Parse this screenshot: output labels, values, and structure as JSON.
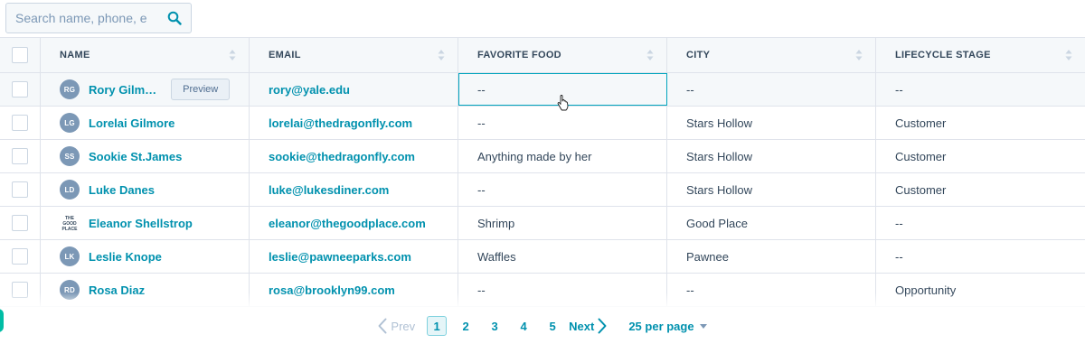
{
  "search": {
    "placeholder": "Search name, phone, e",
    "icon": "search-icon"
  },
  "columns": [
    "NAME",
    "EMAIL",
    "FAVORITE FOOD",
    "CITY",
    "LIFECYCLE STAGE"
  ],
  "rows": [
    {
      "initials": "RG",
      "name": "Rory Gilm…",
      "email": "rory@yale.edu",
      "food": "--",
      "city": "--",
      "stage": "--"
    },
    {
      "initials": "LG",
      "name": "Lorelai Gilmore",
      "email": "lorelai@thedragonfly.com",
      "food": "--",
      "city": "Stars Hollow",
      "stage": "Customer"
    },
    {
      "initials": "SS",
      "name": "Sookie St.James",
      "email": "sookie@thedragonfly.com",
      "food": "Anything made by her",
      "city": "Stars Hollow",
      "stage": "Customer"
    },
    {
      "initials": "LD",
      "name": "Luke Danes",
      "email": "luke@lukesdiner.com",
      "food": "--",
      "city": "Stars Hollow",
      "stage": "Customer"
    },
    {
      "logo": "the-good-place-logo",
      "logo_text": [
        "THE",
        "GOOD",
        "PLACE"
      ],
      "name": "Eleanor Shellstrop",
      "email": "eleanor@thegoodplace.com",
      "food": "Shrimp",
      "city": "Good Place",
      "stage": "--"
    },
    {
      "initials": "LK",
      "name": "Leslie Knope",
      "email": "leslie@pawneeparks.com",
      "food": "Waffles",
      "city": "Pawnee",
      "stage": "--"
    },
    {
      "initials": "RD",
      "name": "Rosa Diaz",
      "email": "rosa@brooklyn99.com",
      "food": "--",
      "city": "--",
      "stage": "Opportunity"
    }
  ],
  "preview_label": "Preview",
  "pagination": {
    "prev": "Prev",
    "pages": [
      "1",
      "2",
      "3",
      "4",
      "5"
    ],
    "current": "1",
    "next": "Next",
    "per_page": "25 per page"
  },
  "colors": {
    "accent": "#0091ae",
    "border": "#dfe3eb",
    "header_bg": "#f5f8fa",
    "avatar": "#7c98b6",
    "selection": "#00a4bd"
  }
}
